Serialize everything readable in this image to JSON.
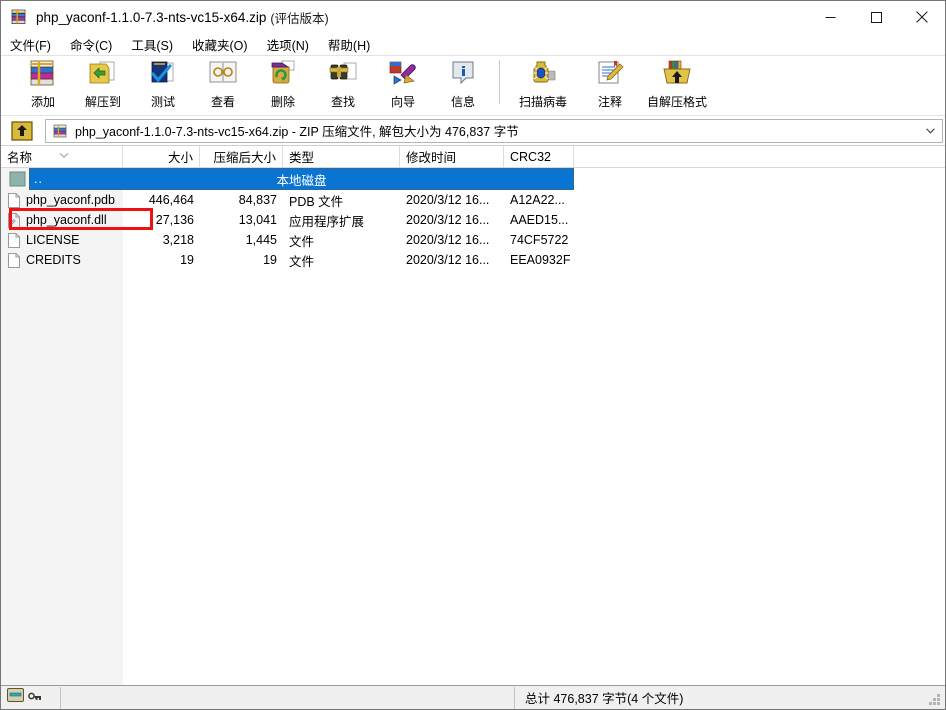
{
  "window": {
    "title": "php_yaconf-1.1.0-7.3-nts-vc15-x64.zip",
    "title_suffix": "(评估版本)",
    "app_icon": "winrar-books-icon",
    "controls": {
      "minimize": "minimize-button",
      "maximize": "maximize-button",
      "close": "close-button"
    }
  },
  "menubar": {
    "items": [
      {
        "label": "文件(F)",
        "name": "menu-file"
      },
      {
        "label": "命令(C)",
        "name": "menu-commands"
      },
      {
        "label": "工具(S)",
        "name": "menu-tools"
      },
      {
        "label": "收藏夹(O)",
        "name": "menu-favorites"
      },
      {
        "label": "选项(N)",
        "name": "menu-options"
      },
      {
        "label": "帮助(H)",
        "name": "menu-help"
      }
    ]
  },
  "toolbar": {
    "buttons": [
      {
        "label": "添加",
        "icon": "add-archive-icon"
      },
      {
        "label": "解压到",
        "icon": "extract-to-icon"
      },
      {
        "label": "测试",
        "icon": "test-archive-icon"
      },
      {
        "label": "查看",
        "icon": "view-file-icon"
      },
      {
        "label": "删除",
        "icon": "delete-icon"
      },
      {
        "label": "查找",
        "icon": "find-icon"
      },
      {
        "label": "向导",
        "icon": "wizard-icon"
      },
      {
        "label": "信息",
        "icon": "info-icon"
      },
      {
        "label": "扫描病毒",
        "icon": "virus-scan-icon"
      },
      {
        "label": "注释",
        "icon": "comment-icon"
      },
      {
        "label": "自解压格式",
        "icon": "sfx-icon"
      }
    ]
  },
  "pathbar": {
    "up_button": "up-one-level-button",
    "icon": "archive-icon",
    "text": "php_yaconf-1.1.0-7.3-nts-vc15-x64.zip - ZIP 压缩文件, 解包大小为 476,837 字节",
    "dropdown": "path-dropdown-chevron"
  },
  "filelist": {
    "columns": [
      {
        "label": "名称",
        "align": "left"
      },
      {
        "label": "大小",
        "align": "right"
      },
      {
        "label": "压缩后大小",
        "align": "right"
      },
      {
        "label": "类型",
        "align": "left"
      },
      {
        "label": "修改时间",
        "align": "left"
      },
      {
        "label": "CRC32",
        "align": "left"
      }
    ],
    "sort_indicator": "chevron-down-icon",
    "parent_row": {
      "name": "..",
      "type_label": "本地磁盘",
      "selected": true,
      "icon": "folder-up-icon"
    },
    "rows": [
      {
        "name": "php_yaconf.pdb",
        "size": "446,464",
        "packed": "84,837",
        "type": "PDB 文件",
        "modified": "2020/3/12 16...",
        "crc32": "A12A22...",
        "icon": "generic-file-icon",
        "highlighted": false
      },
      {
        "name": "php_yaconf.dll",
        "size": "27,136",
        "packed": "13,041",
        "type": "应用程序扩展",
        "modified": "2020/3/12 16...",
        "crc32": "AAED15...",
        "icon": "dll-file-icon",
        "highlighted": true
      },
      {
        "name": "LICENSE",
        "size": "3,218",
        "packed": "1,445",
        "type": "文件",
        "modified": "2020/3/12 16...",
        "crc32": "74CF5722",
        "icon": "generic-file-icon",
        "highlighted": false
      },
      {
        "name": "CREDITS",
        "size": "19",
        "packed": "19",
        "type": "文件",
        "modified": "2020/3/12 16...",
        "crc32": "EEA0932F",
        "icon": "generic-file-icon",
        "highlighted": false
      }
    ]
  },
  "statusbar": {
    "disk_icon": "drive-icon",
    "key_icon": "key-icon",
    "total_text": "总计 476,837 字节(4 个文件)"
  },
  "colors": {
    "selection_blue": "#0a74d3",
    "annotation_red": "#ee1111",
    "name_column_tint": "#f4f4f4",
    "statusbar_bg": "#f0f0f0"
  }
}
